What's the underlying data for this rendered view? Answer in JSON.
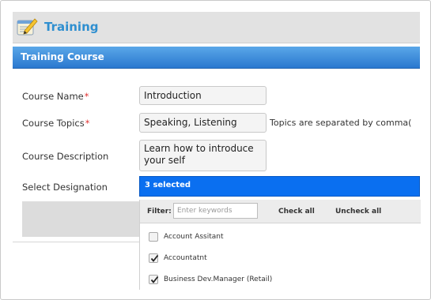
{
  "header": {
    "title": "Training",
    "icon": "notepad-pencil-icon"
  },
  "section": {
    "title": "Training Course"
  },
  "form": {
    "course_name": {
      "label": "Course Name",
      "required_mark": "*",
      "value": "Introduction"
    },
    "course_topics": {
      "label": "Course Topics",
      "required_mark": "*",
      "value": "Speaking, Listening",
      "hint": "Topics are separated by comma("
    },
    "course_description": {
      "label": "Course Description",
      "value": "Learn how to introduce your self"
    },
    "designation": {
      "label": "Select Designation",
      "selected_text": "3 selected"
    }
  },
  "dropdown": {
    "filter_label": "Filter:",
    "filter_placeholder": "Enter keywords",
    "check_all": "Check all",
    "uncheck_all": "Uncheck all",
    "options": [
      {
        "label": "Account Assitant",
        "checked": false
      },
      {
        "label": "Accountatnt",
        "checked": true
      },
      {
        "label": "Business Dev.Manager (Retail)",
        "checked": true
      }
    ]
  },
  "colors": {
    "accent": "#2f8fd0",
    "section_bar": "#2a78cf",
    "select_bar": "#0a6ff0",
    "required": "#e03232"
  }
}
